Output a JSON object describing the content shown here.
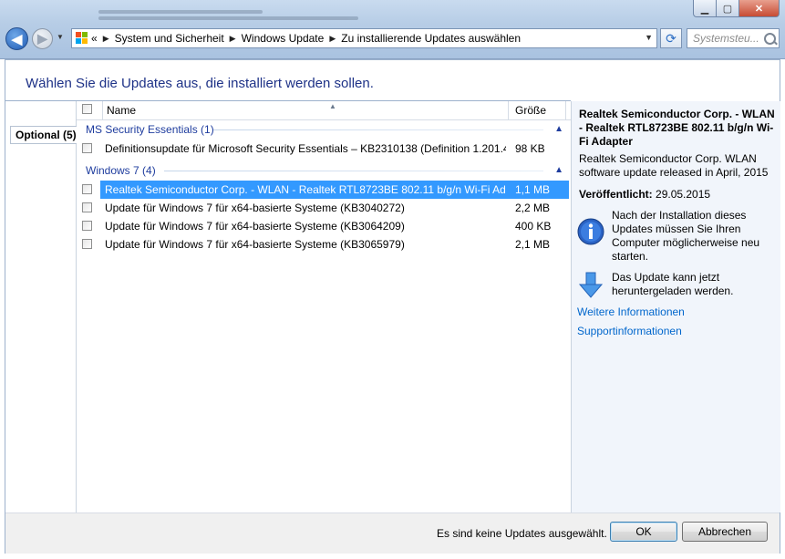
{
  "window": {
    "controls": {
      "minimize": "▁",
      "maximize": "▢",
      "close": "✕"
    }
  },
  "navigation": {
    "back_icon": "back-arrow-icon",
    "forward_icon": "forward-arrow-icon"
  },
  "address": {
    "overflow": "«",
    "crumbs": [
      "System und Sicherheit",
      "Windows Update",
      "Zu installierende Updates auswählen"
    ],
    "separator": "▶"
  },
  "search": {
    "placeholder": "Systemsteu..."
  },
  "page": {
    "title": "Wählen Sie die Updates aus, die installiert werden sollen."
  },
  "categories": [
    {
      "label": "Optional (5)"
    }
  ],
  "list": {
    "columns": {
      "name": "Name",
      "size": "Größe"
    },
    "groups": [
      {
        "label": "MS Security Essentials (1)",
        "rows": [
          {
            "name": "Definitionsupdate für Microsoft Security Essentials – KB2310138 (Definition 1.201.4...",
            "size": "98 KB"
          }
        ]
      },
      {
        "label": "Windows 7 (4)",
        "rows": [
          {
            "name": "Realtek Semiconductor Corp. - WLAN - Realtek RTL8723BE 802.11 b/g/n Wi-Fi Ad...",
            "size": "1,1 MB",
            "selected": true
          },
          {
            "name": "Update für Windows 7 für x64-basierte Systeme (KB3040272)",
            "size": "2,2 MB"
          },
          {
            "name": "Update für Windows 7 für x64-basierte Systeme (KB3064209)",
            "size": "400 KB"
          },
          {
            "name": "Update für Windows 7 für x64-basierte Systeme (KB3065979)",
            "size": "2,1 MB"
          }
        ]
      }
    ]
  },
  "details": {
    "title": "Realtek Semiconductor Corp. - WLAN - Realtek RTL8723BE 802.11 b/g/n Wi-Fi Adapter",
    "description": "Realtek Semiconductor Corp. WLAN software update released in April, 2015",
    "published_label": "Veröffentlicht:",
    "published_value": "29.05.2015",
    "restart_note": "Nach der Installation dieses Updates müssen Sie Ihren Computer möglicherweise neu starten.",
    "download_note": "Das Update kann jetzt heruntergeladen werden.",
    "links": [
      "Weitere Informationen",
      "Supportinformationen"
    ]
  },
  "footer": {
    "status": "Es sind keine Updates ausgewählt.",
    "ok": "OK",
    "cancel": "Abbrechen"
  },
  "colors": {
    "selection": "#3399ff",
    "title_blue": "#1e3287",
    "link_blue": "#0066cc",
    "group_blue": "#1e3c9e"
  }
}
